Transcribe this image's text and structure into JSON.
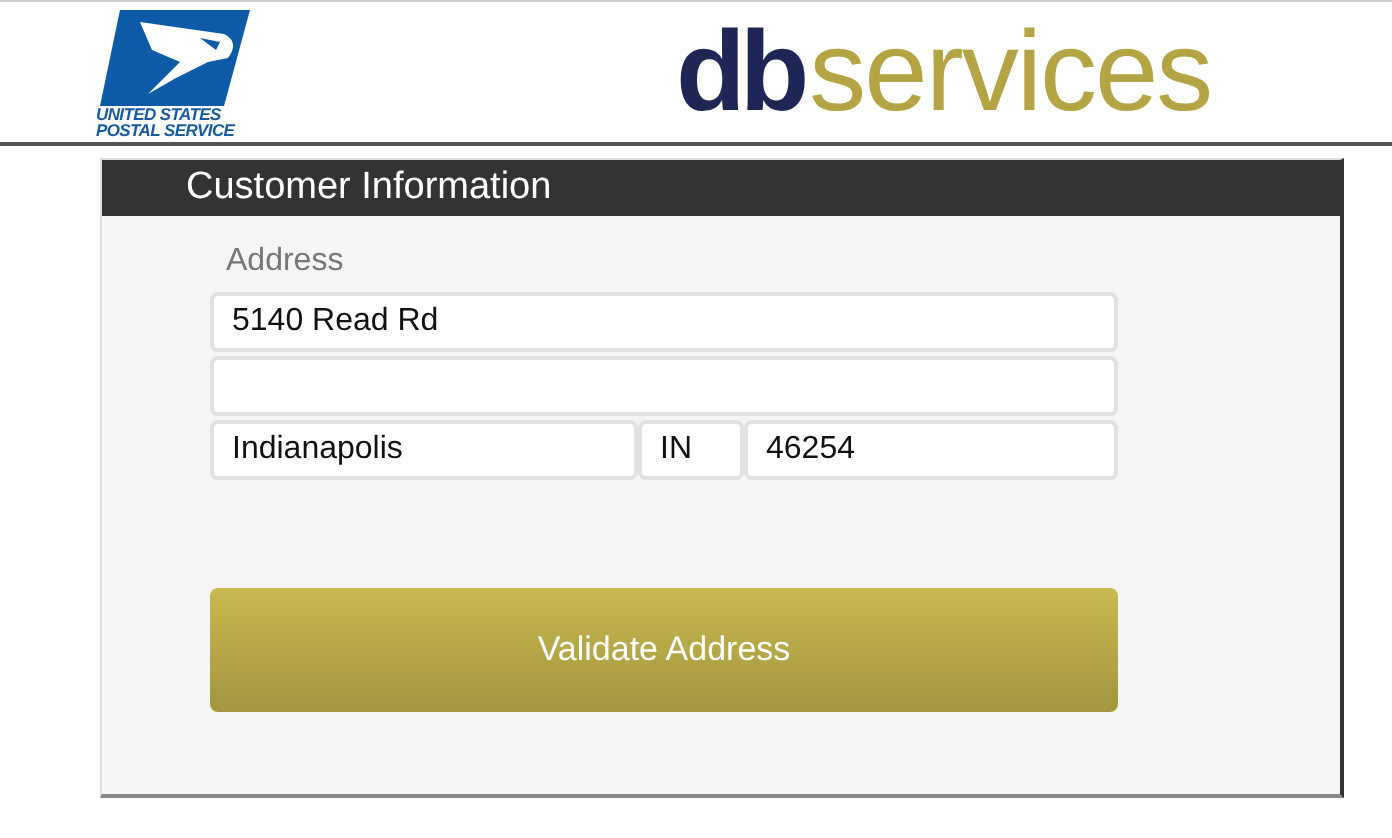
{
  "header": {
    "postal_logo_lines": [
      "UNITED STATES",
      "POSTAL SERVICE"
    ],
    "brand": {
      "prefix": "db",
      "suffix": "services"
    }
  },
  "panel": {
    "title": "Customer Information",
    "address_label": "Address",
    "fields": [
      {
        "kind": "full",
        "value": "5140 Read Rd"
      },
      {
        "kind": "full"
      },
      {
        "kind": "city",
        "value": "Indianapolis"
      },
      {
        "kind": "state",
        "value": "IN"
      },
      {
        "kind": "zip",
        "value": "46254"
      }
    ],
    "button": "Validate Address"
  }
}
